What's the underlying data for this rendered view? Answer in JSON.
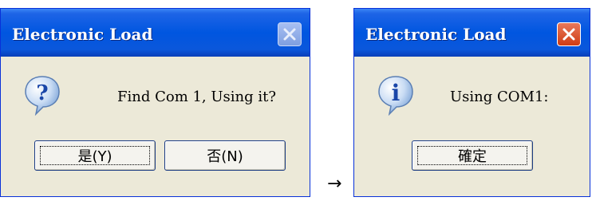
{
  "dialog1": {
    "title": "Electronic Load",
    "message": "Find Com 1, Using it?",
    "icon": "question-icon",
    "buttons": {
      "yes": "是(Y)",
      "no": "否(N)"
    }
  },
  "dialog2": {
    "title": "Electronic Load",
    "message": "Using COM1:",
    "icon": "info-icon",
    "buttons": {
      "ok": "確定"
    }
  },
  "arrow": "→",
  "colors": {
    "titlebar": "#0056e0",
    "dialog_bg": "#ECE9D8",
    "close_active": "#cf3d14",
    "close_inactive": "#7f9fe0"
  }
}
